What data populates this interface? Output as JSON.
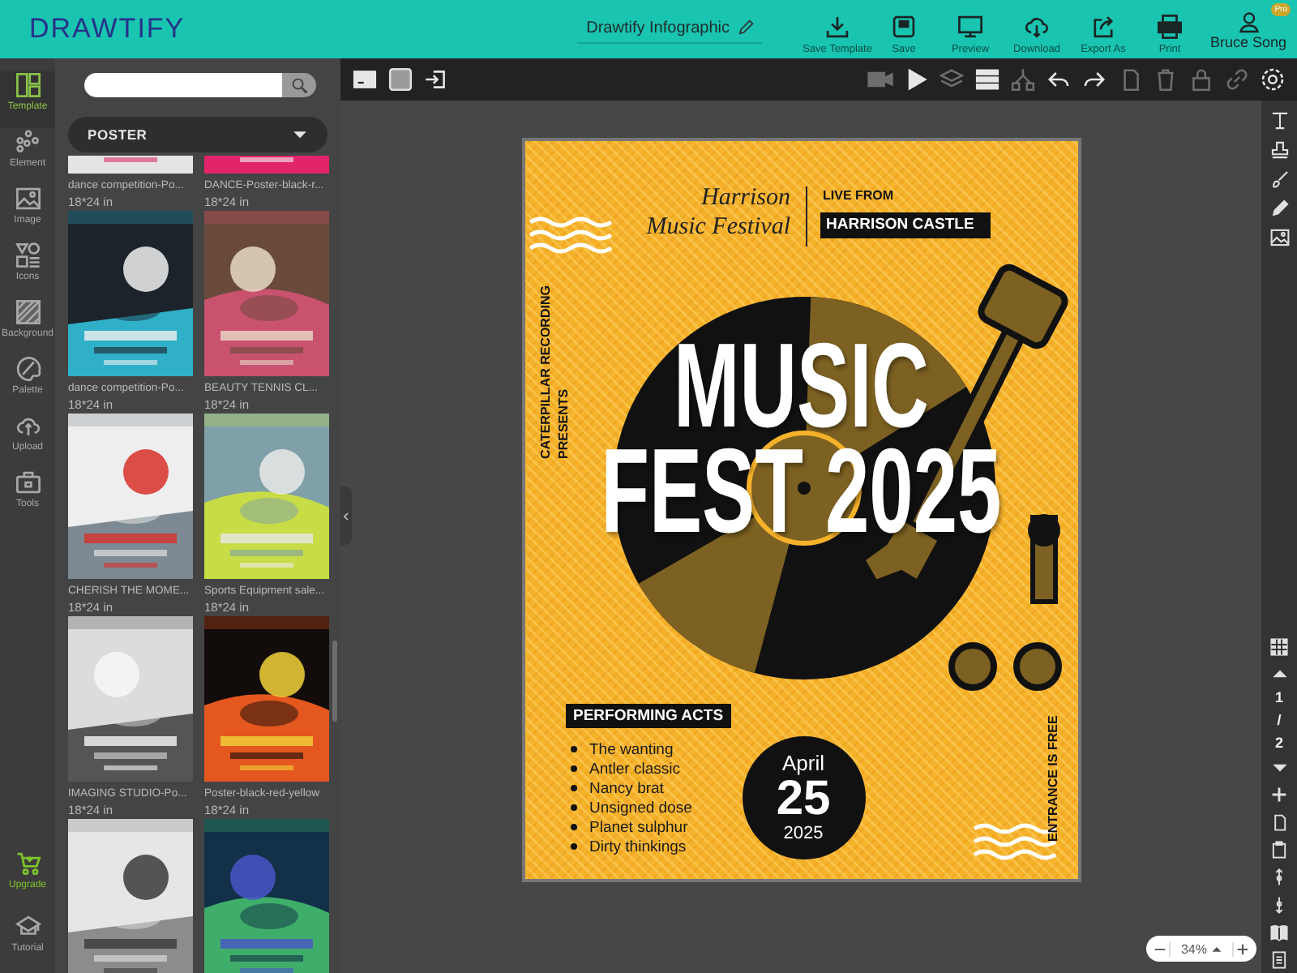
{
  "header": {
    "logo": "DRAWTIFY",
    "document_title": "Drawtify Infographic",
    "actions": [
      {
        "label": "Save Template"
      },
      {
        "label": "Save"
      },
      {
        "label": "Preview"
      },
      {
        "label": "Download"
      },
      {
        "label": "Export As"
      },
      {
        "label": "Print"
      }
    ],
    "user": {
      "name": "Bruce Song",
      "badge": "Pro"
    }
  },
  "nav": [
    {
      "label": "Template",
      "selected": true
    },
    {
      "label": "Element",
      "selected": false
    },
    {
      "label": "Image",
      "selected": false
    },
    {
      "label": "Icons",
      "selected": false
    },
    {
      "label": "Background",
      "selected": false
    },
    {
      "label": "Palette",
      "selected": false
    },
    {
      "label": "Upload",
      "selected": false
    },
    {
      "label": "Tools",
      "selected": false
    }
  ],
  "nav_bottom": [
    {
      "label": "Upgrade",
      "accent": true
    },
    {
      "label": "Tutorial",
      "accent": false
    }
  ],
  "panel": {
    "category": "POSTER",
    "templates": [
      {
        "name": "dance competition-Po...",
        "size": "18*24 in",
        "kind": "picture"
      },
      {
        "name": "DANCE-Poster-black-r...",
        "size": "18*24 in",
        "kind": "picture"
      },
      {
        "name": "dance competition-Po...",
        "size": "18*24 in",
        "kind": "picture"
      },
      {
        "name": "BEAUTY TENNIS CL...",
        "size": "18*24 in",
        "kind": "picture"
      },
      {
        "name": "CHERISH THE MOME...",
        "size": "18*24 in",
        "kind": "picture"
      },
      {
        "name": "Sports Equipment sale...",
        "size": "18*24 in",
        "kind": "picture"
      },
      {
        "name": "IMAGING STUDIO-Po...",
        "size": "18*24 in",
        "kind": "picture"
      },
      {
        "name": "Poster-black-red-yellow",
        "size": "18*24 in",
        "kind": "picture"
      },
      {
        "kind": "picture"
      },
      {
        "kind": "picture"
      }
    ]
  },
  "toolbar": {
    "right": [
      {
        "disabled": true
      },
      {
        "disabled": false
      },
      {
        "disabled": true
      },
      {
        "disabled": false
      },
      {
        "disabled": true
      },
      {
        "disabled": false
      },
      {
        "disabled": false
      },
      {
        "disabled": true
      },
      {
        "disabled": true
      },
      {
        "disabled": true
      },
      {
        "disabled": true
      },
      {
        "disabled": false
      }
    ]
  },
  "poster": {
    "title_lines": [
      "Harrison",
      "Music Festival"
    ],
    "live_label": "LIVE FROM",
    "venue": "HARRISON CASTLE",
    "presenter_lines": [
      "CATERPILLAR RECORDING",
      "PRESENTS"
    ],
    "headline_lines": [
      "MUSIC",
      "FEST 2025"
    ],
    "acts_heading": "PERFORMING ACTS",
    "acts": [
      "The wanting",
      "Antler classic",
      "Nancy brat",
      "Unsigned dose",
      "Planet sulphur",
      "Dirty thinkings"
    ],
    "date": {
      "month": "April",
      "day": "25",
      "year": "2025"
    },
    "footer_note": "ENTRANCE IS FREE"
  },
  "pager": {
    "current": "1",
    "separator": "/",
    "total": "2"
  },
  "zoom": {
    "value": "34%"
  }
}
